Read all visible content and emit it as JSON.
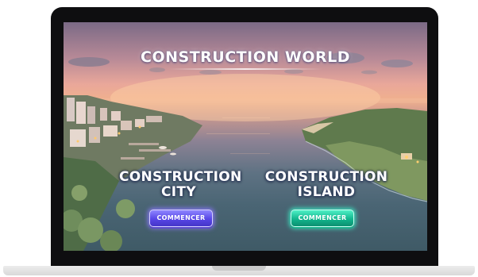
{
  "app": {
    "title": "CONSTRUCTION WORLD"
  },
  "worlds": [
    {
      "name": "CONSTRUCTION CITY",
      "line1": "CONSTRUCTION",
      "line2": "CITY",
      "button_label": "COMMENCER",
      "button_color": "#5846e6"
    },
    {
      "name": "CONSTRUCTION ISLAND",
      "line1": "CONSTRUCTION",
      "line2": "ISLAND",
      "button_label": "COMMENCER",
      "button_color": "#12b58d"
    }
  ],
  "colors": {
    "device_bezel": "#0e0e10",
    "sky_top": "#7b6a86",
    "sky_glow": "#f0b08e",
    "sea": "#4a6574"
  },
  "icons": {
    "background": "coastal-city-landscape-illustration"
  }
}
